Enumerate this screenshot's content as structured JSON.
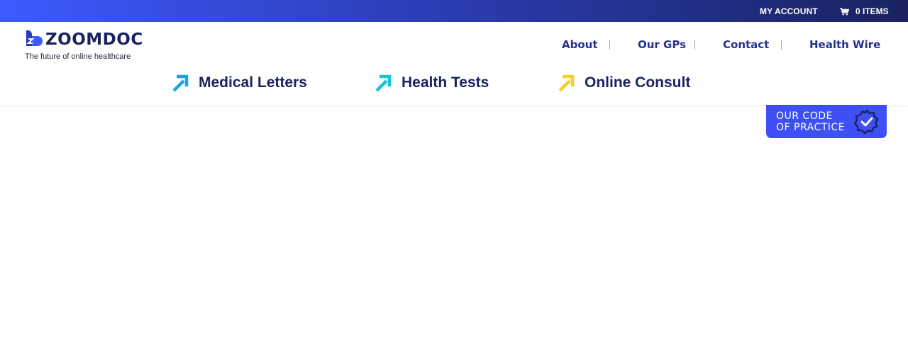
{
  "topbar": {
    "account_label": "MY ACCOUNT",
    "cart_label": "0 ITEMS",
    "gradient_start": "#3d5afe",
    "gradient_end": "#1a2260"
  },
  "logo": {
    "wordmark": "ZOOMDOC",
    "tagline": "The future of online healthcare"
  },
  "nav": {
    "items": [
      {
        "label": "About"
      },
      {
        "label": "Our GPs"
      },
      {
        "label": "Contact"
      },
      {
        "label": "Health Wire"
      }
    ]
  },
  "services": [
    {
      "label": "Medical Letters",
      "icon": "arrow-up-right-icon",
      "color": "#1aa3e8"
    },
    {
      "label": "Health Tests",
      "icon": "arrow-up-right-icon",
      "color": "#19c2d6"
    },
    {
      "label": "Online Consult",
      "icon": "arrow-up-right-icon",
      "color": "#f5cf2b"
    }
  ],
  "badge": {
    "line1": "OUR CODE",
    "line2": "OF PRACTICE",
    "color": "#3d4ff5",
    "icon": "verified-check-icon"
  },
  "colors": {
    "navy": "#1a2260",
    "nav_link": "#27318f"
  }
}
